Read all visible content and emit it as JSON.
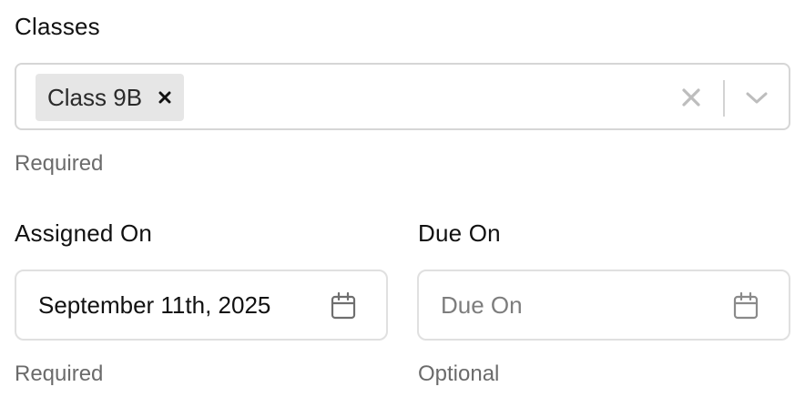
{
  "classes": {
    "label": "Classes",
    "selected_chips": [
      "Class 9B"
    ],
    "helper": "Required",
    "icons": {
      "remove_chip": "close-icon",
      "clear_all": "clear-icon",
      "dropdown": "chevron-down-icon"
    }
  },
  "assigned_on": {
    "label": "Assigned On",
    "value": "September 11th, 2025",
    "helper": "Required",
    "icon": "calendar-icon"
  },
  "due_on": {
    "label": "Due On",
    "placeholder": "Due On",
    "helper": "Optional",
    "icon": "calendar-icon"
  },
  "colors": {
    "text": "#111111",
    "helper_text": "#6b6b6b",
    "chip_bg": "#e6e6e6",
    "border": "#d6d6d6"
  }
}
